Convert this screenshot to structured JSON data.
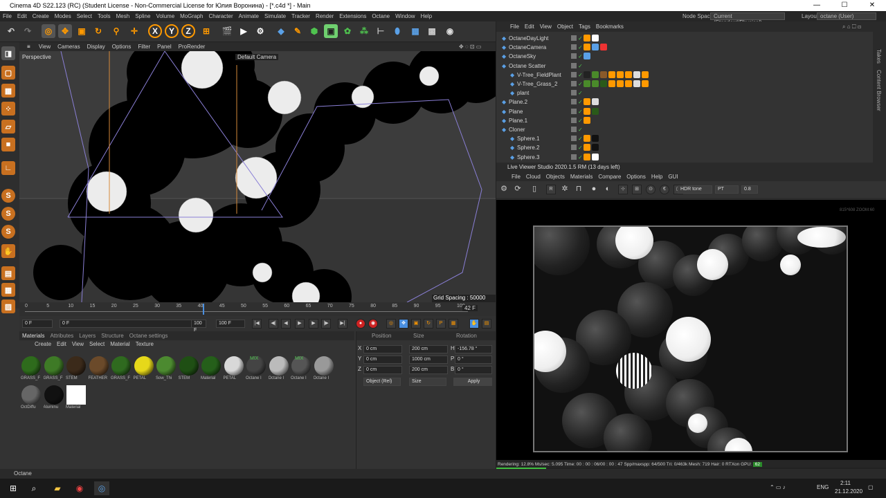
{
  "window": {
    "title": "Cinema 4D S22.123 (RC) (Student License - Non-Commercial License for Юлия Воронина) - [*.c4d *] - Main",
    "minimize": "—",
    "maximize": "☐",
    "close": "✕"
  },
  "menu": {
    "items": [
      "File",
      "Edit",
      "Create",
      "Modes",
      "Select",
      "Tools",
      "Mesh",
      "Spline",
      "Volume",
      "MoGraph",
      "Character",
      "Animate",
      "Simulate",
      "Tracker",
      "Render",
      "Extensions",
      "Octane",
      "Window",
      "Help"
    ],
    "node_space_label": "Node Space:",
    "node_space_value": "Current (Standard/Physical)",
    "layout_label": "Layout:",
    "layout_value": "octane (User)"
  },
  "viewport": {
    "menu": [
      "View",
      "Cameras",
      "Display",
      "Options",
      "Filter",
      "Panel",
      "ProRender"
    ],
    "label": "Perspective",
    "camera": "Default Camera",
    "grid_spacing": "Grid Spacing : 50000 cm"
  },
  "timeline": {
    "ticks": [
      "0",
      "5",
      "10",
      "15",
      "20",
      "25",
      "30",
      "35",
      "40",
      "45",
      "50",
      "55",
      "60",
      "65",
      "70",
      "75",
      "80",
      "85",
      "90",
      "95",
      "100"
    ],
    "current_frame_label": "42 F",
    "start": "0 F",
    "start2": "0 F",
    "end": "100 F",
    "end2": "100 F"
  },
  "materials": {
    "tabs": [
      "Materials",
      "Attributes",
      "Layers",
      "Structure",
      "Octane settings"
    ],
    "menu": [
      "Create",
      "Edit",
      "View",
      "Select",
      "Material",
      "Texture"
    ],
    "items": [
      {
        "name": "GRASS_F",
        "color": "#2e6b1c"
      },
      {
        "name": "GRASS_F",
        "color": "#3e7a26"
      },
      {
        "name": "STEM",
        "color": "#3b2a1a"
      },
      {
        "name": "FEATHER",
        "color": "#6b4a2a"
      },
      {
        "name": "GRASS_F",
        "color": "#2f6a1f"
      },
      {
        "name": "PETAL",
        "color": "#e6d81a"
      },
      {
        "name": "Sow_Thi",
        "color": "#4c8a30"
      },
      {
        "name": "STEM",
        "color": "#1f4f14"
      },
      {
        "name": "Material",
        "color": "#255f1a"
      },
      {
        "name": "PETAL",
        "color": "#d8d8d8"
      },
      {
        "name": "Octane I",
        "color": "#444444"
      },
      {
        "name": "Octane I",
        "color": "#bbbbbb"
      },
      {
        "name": "Octane I",
        "color": "#555555"
      },
      {
        "name": "Octane I",
        "color": "#999999"
      },
      {
        "name": "OctDiffu",
        "color": "#666666"
      },
      {
        "name": "Aluminu",
        "color": "#111111"
      },
      {
        "name": "Material",
        "color": "#ffffff"
      }
    ],
    "mix_label": "MIX"
  },
  "coords": {
    "headers": [
      "Position",
      "Size",
      "Rotation"
    ],
    "rows": [
      {
        "axis": "X",
        "pos": "0 cm",
        "size": "200 cm",
        "rlabel": "H",
        "rot": "-156.78 °"
      },
      {
        "axis": "Y",
        "pos": "0 cm",
        "size": "1000 cm",
        "rlabel": "P",
        "rot": "0 °"
      },
      {
        "axis": "Z",
        "pos": "0 cm",
        "size": "200 cm",
        "rlabel": "B",
        "rot": "0 °"
      }
    ],
    "mode": "Object (Rel)",
    "size_mode": "Size",
    "apply": "Apply"
  },
  "objects": {
    "menu": [
      "File",
      "Edit",
      "View",
      "Object",
      "Tags",
      "Bookmarks"
    ],
    "rows": [
      {
        "name": "OctaneDayLight",
        "indent": 0
      },
      {
        "name": "OctaneCamera",
        "indent": 0
      },
      {
        "name": "OctaneSky",
        "indent": 0
      },
      {
        "name": "Octane Scatter",
        "indent": 0
      },
      {
        "name": "V-Tree_FieldPlant",
        "indent": 2
      },
      {
        "name": "V-Tree_Grass_2",
        "indent": 2
      },
      {
        "name": "plant",
        "indent": 2
      },
      {
        "name": "Plane.2",
        "indent": 0
      },
      {
        "name": "Plane",
        "indent": 0
      },
      {
        "name": "Plane.1",
        "indent": 0
      },
      {
        "name": "Cloner",
        "indent": 0
      },
      {
        "name": "Sphere.1",
        "indent": 2
      },
      {
        "name": "Sphere.2",
        "indent": 2
      },
      {
        "name": "Sphere.3",
        "indent": 2
      }
    ],
    "side_tabs": [
      "Takes",
      "Content Browser"
    ]
  },
  "live_viewer": {
    "title": "Live Viewer Studio 2020.1.5 RM (13 days left)",
    "menu": [
      "File",
      "Cloud",
      "Objects",
      "Materials",
      "Compare",
      "Options",
      "Help",
      "GUI"
    ],
    "tonemap": "HDR tone",
    "channel": "PT",
    "value": "0.8",
    "zoom": "815*608 ZOOM:60",
    "status": "Rendering: 12.8%   Ms/sec: 5.095   Time: 00 : 00 : 06/00 : 00 : 47   Spp/maxspp: 64/500   Tri: 0/463k   Mesh: 719   Hair: 0   RTXon   GPU:",
    "gpu_temp": "62",
    "progress": 0.128
  },
  "statusbar": {
    "text": "Octane"
  },
  "taskbar": {
    "lang": "ENG",
    "time": "2:11",
    "date": "21.12.2020"
  }
}
